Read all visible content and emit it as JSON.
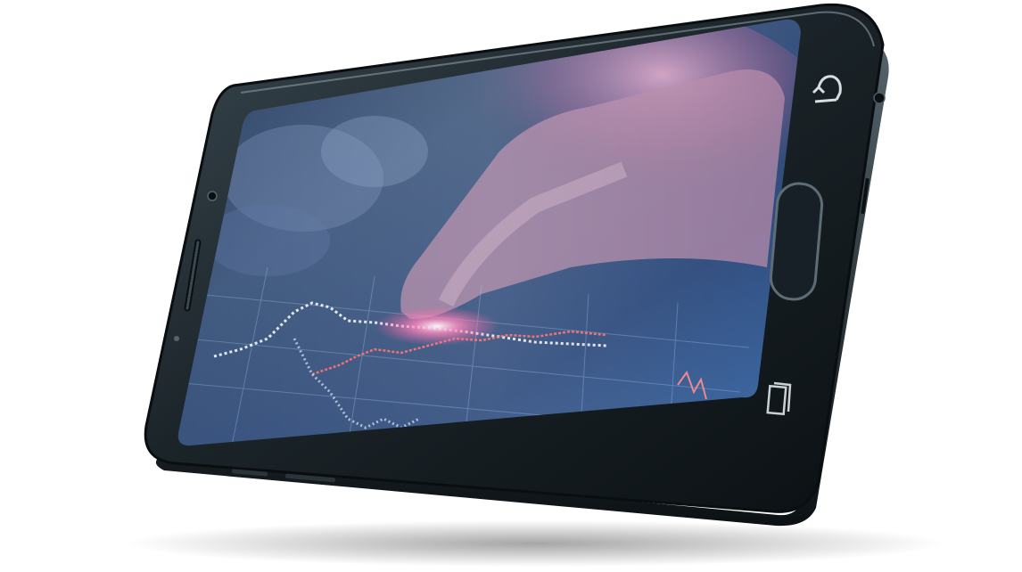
{
  "scene": {
    "subject": "smartphone",
    "orientation": "landscape",
    "device_color": "#1c2429",
    "screen_tint": "#3b5d8f",
    "accent_color": "#ff4f9a"
  },
  "icons": {
    "back": "back-icon",
    "home": "home-button",
    "recents": "recents-icon",
    "camera": "front-camera-icon",
    "speaker": "earpiece-speaker"
  }
}
